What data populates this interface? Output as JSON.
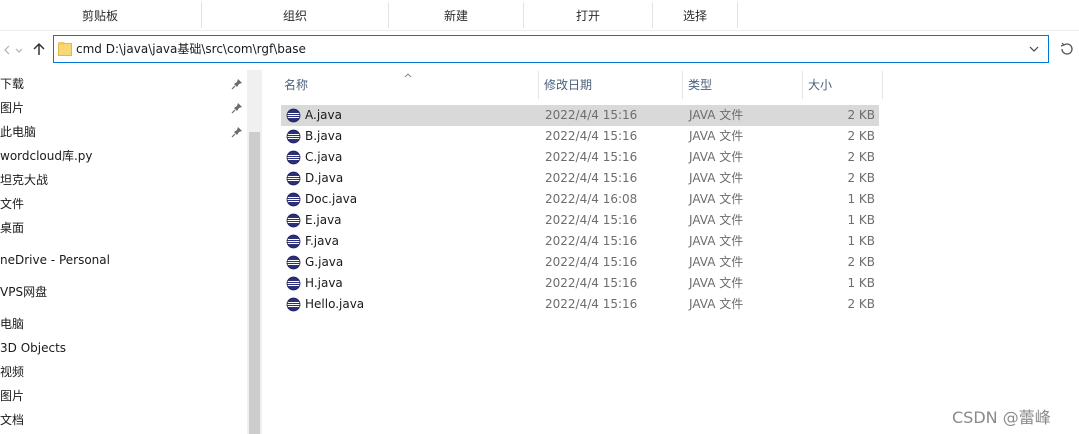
{
  "ribbon": {
    "groups": [
      "剪贴板",
      "组织",
      "新建",
      "打开",
      "选择"
    ]
  },
  "address": {
    "value": "cmd D:\\java\\java基础\\src\\com\\rgf\\base"
  },
  "nav": {
    "back_icon": "back-arrow-icon",
    "forward_icon": "forward-arrow-icon",
    "items": [
      {
        "label": "下载",
        "pinned": true
      },
      {
        "label": "图片",
        "pinned": true
      },
      {
        "label": "此电脑",
        "pinned": true
      },
      {
        "label": "wordcloud库.py",
        "pinned": false
      },
      {
        "label": "坦克大战",
        "pinned": false
      },
      {
        "label": "文件",
        "pinned": false
      },
      {
        "label": "桌面",
        "pinned": false
      },
      {
        "label": "neDrive - Personal",
        "pinned": false
      },
      {
        "label": "VPS网盘",
        "pinned": false
      },
      {
        "label": "电脑",
        "pinned": false
      },
      {
        "label": "3D Objects",
        "pinned": false
      },
      {
        "label": "视频",
        "pinned": false
      },
      {
        "label": "图片",
        "pinned": false
      },
      {
        "label": "文档",
        "pinned": false
      }
    ]
  },
  "columns": {
    "name": "名称",
    "date": "修改日期",
    "type": "类型",
    "size": "大小"
  },
  "files": [
    {
      "name": "A.java",
      "date": "2022/4/4 15:16",
      "type": "JAVA 文件",
      "size": "2 KB",
      "selected": true
    },
    {
      "name": "B.java",
      "date": "2022/4/4 15:16",
      "type": "JAVA 文件",
      "size": "2 KB",
      "selected": false
    },
    {
      "name": "C.java",
      "date": "2022/4/4 15:16",
      "type": "JAVA 文件",
      "size": "2 KB",
      "selected": false
    },
    {
      "name": "D.java",
      "date": "2022/4/4 15:16",
      "type": "JAVA 文件",
      "size": "2 KB",
      "selected": false
    },
    {
      "name": "Doc.java",
      "date": "2022/4/4 16:08",
      "type": "JAVA 文件",
      "size": "1 KB",
      "selected": false
    },
    {
      "name": "E.java",
      "date": "2022/4/4 15:16",
      "type": "JAVA 文件",
      "size": "1 KB",
      "selected": false
    },
    {
      "name": "F.java",
      "date": "2022/4/4 15:16",
      "type": "JAVA 文件",
      "size": "1 KB",
      "selected": false
    },
    {
      "name": "G.java",
      "date": "2022/4/4 15:16",
      "type": "JAVA 文件",
      "size": "2 KB",
      "selected": false
    },
    {
      "name": "H.java",
      "date": "2022/4/4 15:16",
      "type": "JAVA 文件",
      "size": "1 KB",
      "selected": false
    },
    {
      "name": "Hello.java",
      "date": "2022/4/4 15:16",
      "type": "JAVA 文件",
      "size": "2 KB",
      "selected": false
    }
  ],
  "watermark": "CSDN @蕾峰",
  "colors": {
    "accent": "#0078d7",
    "selected_row": "#d9d9d9",
    "header_text": "#4c607a",
    "folder": "#f8d775"
  }
}
